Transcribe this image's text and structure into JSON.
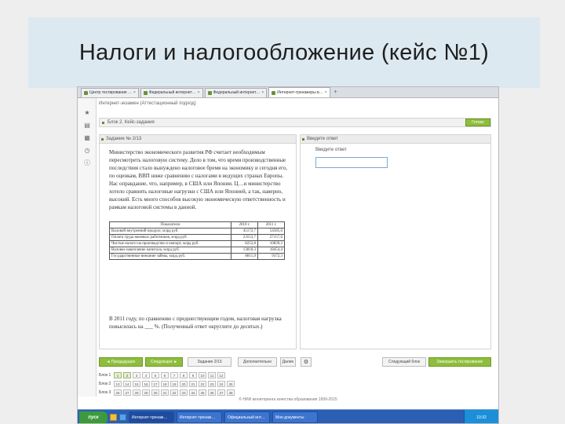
{
  "slide": {
    "title": "Налоги и налогообложение (кейс №1)"
  },
  "browser": {
    "tabs": [
      {
        "label": "Центр тестирования …",
        "active": false
      },
      {
        "label": "Федеральный интернет…",
        "active": false
      },
      {
        "label": "Федеральный интернет…",
        "active": false
      },
      {
        "label": "Интернет-тренажеры в…",
        "active": true
      }
    ],
    "new_tab": "+"
  },
  "app": {
    "breadcrumb": "Интернет-экзамен (Аттестационный подход)",
    "topic": "Блок 2. Кейс-задания",
    "topic_button": "Готово",
    "task_panel": {
      "header": "Задание № 2/13",
      "text": "Министерство экономического развития РФ считает необходимым пересмотреть налоговую систему. Дело в том, что время производственные последствия стало вынуждено налоговое бремя на экономику и сегодня его, по оценкам, ВВП ниже сравнению с налогами в ведущих странах Европы. Нас оправдание, что, например, в США или Японии. Ц…и министерство хотело сравнить налоговые нагрузки с США или Японией, а так, наверно, высокий. Есть много способов высокую экономическую ответственность и рамкам налоговой системы в данной.",
      "table": {
        "headers": [
          "Показатели",
          "2010 г.",
          "2011 г."
        ],
        "rows": [
          [
            "Валовой внутренний продукт, млрд руб.",
            "45172,7",
            "54585,6"
          ],
          [
            "Оплата труда наемных работников, млрд руб.",
            "23553,7",
            "27157,6"
          ],
          [
            "Чистые налоги на производство и импорт, млрд руб.",
            "8252,8",
            "10839,3"
          ],
          [
            "Валовое накопление капитала, млрд руб.",
            "13810,3",
            "18454,4"
          ],
          [
            "Государственные внешние займы, млрд руб.",
            "8811,9",
            "9372,3"
          ]
        ]
      },
      "question": "В 2011 году, по сравнению с предшествующим годом, налоговая нагрузка повысилась на ___ %. (Полученный ответ округлите до десятых.)"
    },
    "answer_panel": {
      "header": "Введите ответ",
      "label": "Введите ответ",
      "input_value": "",
      "input_placeholder": ""
    },
    "nav": {
      "prev": "◄ Предыдущее",
      "next": "Следующее ►",
      "task_select": "Задание 2/13",
      "help": "Дополнительно",
      "go": "Далее",
      "settings_icon": "gear-icon",
      "finish_block": "Следующий блок",
      "finish_exam": "Завершить тестирование"
    },
    "blocks": [
      {
        "label": "Блок 1",
        "cells": [
          "1",
          "2",
          "3",
          "4",
          "5",
          "6",
          "7",
          "8",
          "9",
          "10",
          "11",
          "12"
        ]
      },
      {
        "label": "Блок 2",
        "cells": [
          "13",
          "14",
          "15",
          "16",
          "17",
          "18",
          "19",
          "20",
          "21",
          "22",
          "23",
          "24",
          "25"
        ]
      },
      {
        "label": "Блок 3",
        "cells": [
          "26",
          "27",
          "28",
          "29",
          "30",
          "31",
          "32",
          "33",
          "34",
          "35",
          "36",
          "37",
          "38"
        ]
      }
    ],
    "footer": "© НИИ мониторинга качества образования 1999-2015"
  },
  "taskbar": {
    "start": "пуск",
    "items": [
      {
        "label": "Интернет-тренаж…",
        "active": true
      },
      {
        "label": "Интернет-тренаж…",
        "active": false
      },
      {
        "label": "Официальный инт…",
        "active": false
      },
      {
        "label": "Мои документы",
        "active": false
      }
    ],
    "clock": "10:32"
  },
  "colors": {
    "accent": "#8dbe3c",
    "title_band": "#dde9f0",
    "taskbar": "#2b5fb4"
  }
}
